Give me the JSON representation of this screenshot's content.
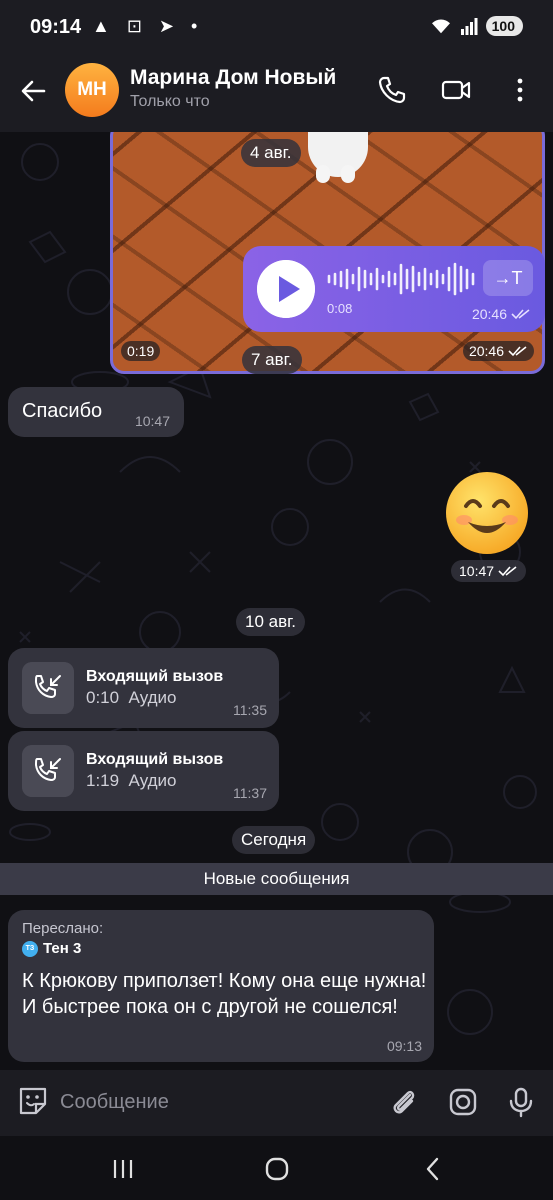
{
  "status_bar": {
    "time": "09:14",
    "icons_left": "▲ ⊡ ➤ •",
    "battery": "100"
  },
  "header": {
    "avatar_initials": "МН",
    "contact_name": "Марина Дом Новый",
    "status": "Только что"
  },
  "messages": {
    "date_1": "4 авг.",
    "video": {
      "duration": "0:19",
      "time": "20:46"
    },
    "voice": {
      "duration": "0:08",
      "time": "20:46",
      "transcribe_label": "→T"
    },
    "date_2": "7 авг.",
    "thanks": {
      "text": "Спасибо",
      "time": "10:47"
    },
    "emoji_time": "10:47",
    "date_3": "10 авг.",
    "calls": [
      {
        "title": "Входящий вызов",
        "duration": "0:10",
        "kind": "Аудио",
        "time": "11:35"
      },
      {
        "title": "Входящий вызов",
        "duration": "1:19",
        "kind": "Аудио",
        "time": "11:37"
      }
    ],
    "date_4": "Сегодня",
    "new_messages_label": "Новые сообщения",
    "forwarded": {
      "label": "Переслано:",
      "from_initials": "ТЗ",
      "from": "Тен 3",
      "text": "К Крюкову приползет! Кому она еще нужна! И быстрее пока он с другой не сошелся!",
      "time": "09:13"
    }
  },
  "input": {
    "placeholder": "Сообщение"
  },
  "colors": {
    "accent": "#7a6bd8",
    "bubble_in": "#33333d",
    "avatar": "#f47b1d"
  }
}
